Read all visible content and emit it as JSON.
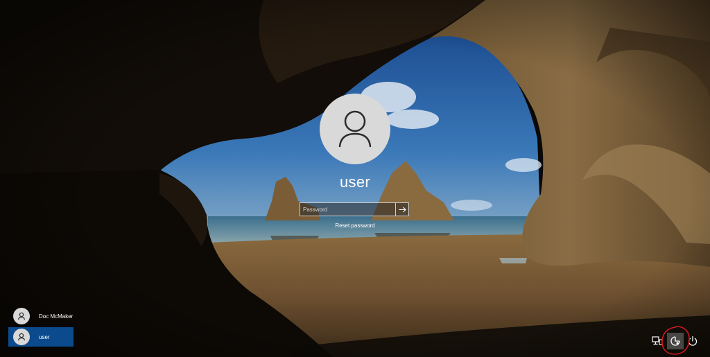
{
  "login": {
    "username": "user",
    "password_placeholder": "Password",
    "password_value": "",
    "reset_password_label": "Reset password"
  },
  "user_list": [
    {
      "name": "Doc McMaker",
      "selected": false
    },
    {
      "name": "user",
      "selected": true
    }
  ],
  "system_icons": [
    "network-icon",
    "ease-of-access-icon",
    "power-icon"
  ],
  "colors": {
    "selected_user_bg": "#0b4a8c",
    "highlight_ring": "#d0161e",
    "avatar_bg": "#d9d9d9"
  }
}
